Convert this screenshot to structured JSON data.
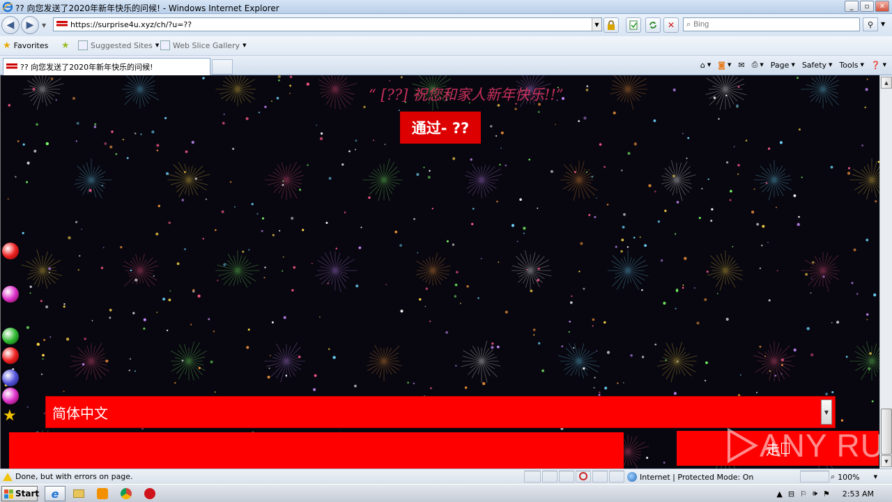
{
  "window": {
    "title": "?? 向您发送了2020年新年快乐的问候! - Windows Internet Explorer",
    "minimize_label": "_",
    "maximize_label": "▫",
    "close_label": "✕"
  },
  "address_bar": {
    "url": "https://surprise4u.xyz/ch/?u=??",
    "search_placeholder": "Bing"
  },
  "favorites_bar": {
    "favorites_label": "Favorites",
    "suggested_sites_label": "Suggested Sites",
    "web_slice_gallery_label": "Web Slice Gallery"
  },
  "tabs": [
    {
      "label": "?? 向您发送了2020年新年快乐的问候!"
    }
  ],
  "command_bar": {
    "page_label": "Page",
    "safety_label": "Safety",
    "tools_label": "Tools"
  },
  "page": {
    "headline": "“ [??] 祝您和家人新年快乐!!”",
    "via_button_label": "通过- ??",
    "language_select_value": "简体中文",
    "go_button_label": "走"
  },
  "colors": {
    "page_background": "#08070f",
    "accent_red": "#ff0000",
    "headline_pink": "#c8305c"
  },
  "watermark": {
    "text": "ANY RUN"
  },
  "status_bar": {
    "message": "Done, but with errors on page.",
    "zone": "Internet | Protected Mode: On",
    "zoom": "100%"
  },
  "taskbar": {
    "start_label": "Start",
    "clock": "2:53 AM"
  }
}
